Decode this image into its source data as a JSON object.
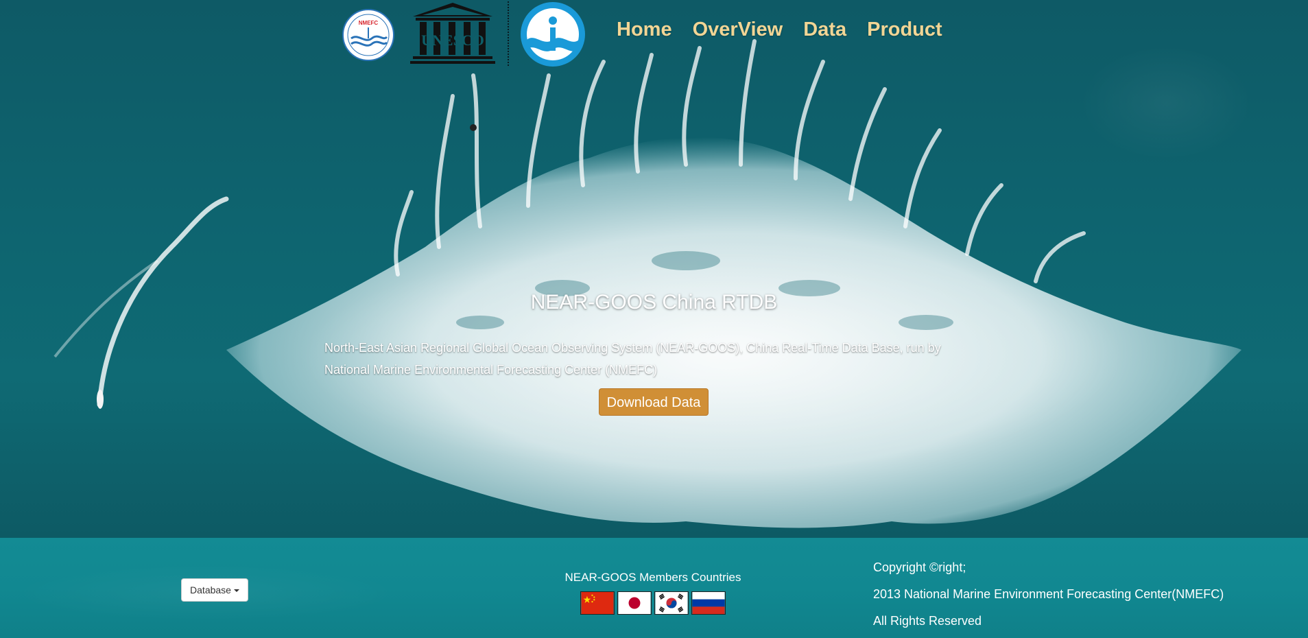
{
  "header": {
    "logos": {
      "nmefc_text": "NMEFC",
      "unesco_text": "UNESCO"
    },
    "nav": [
      {
        "label": "Home"
      },
      {
        "label": "OverView"
      },
      {
        "label": "Data"
      },
      {
        "label": "Product"
      }
    ]
  },
  "hero": {
    "title": "NEAR-GOOS China RTDB",
    "description": "North-East Asian Regional Global Ocean Observing System (NEAR-GOOS), China Real-Time Data Base, run by National Marine Environmental Forecasting Center (NMEFC)",
    "download_label": "Download Data"
  },
  "footer": {
    "database_label": "Database",
    "members_title": "NEAR-GOOS Members Countries",
    "flags": [
      "china-flag",
      "japan-flag",
      "korea-flag",
      "russia-flag"
    ],
    "copyright": {
      "line1": "Copyright ©right;",
      "line2": "2013 National Marine Environment Forecasting Center(NMEFC)",
      "line3": "All Rights Reserved"
    }
  },
  "colors": {
    "nav_text": "#f1d595",
    "download_button": "#d08f36",
    "footer_bg": "#118891",
    "ocean": "#0e6570"
  }
}
